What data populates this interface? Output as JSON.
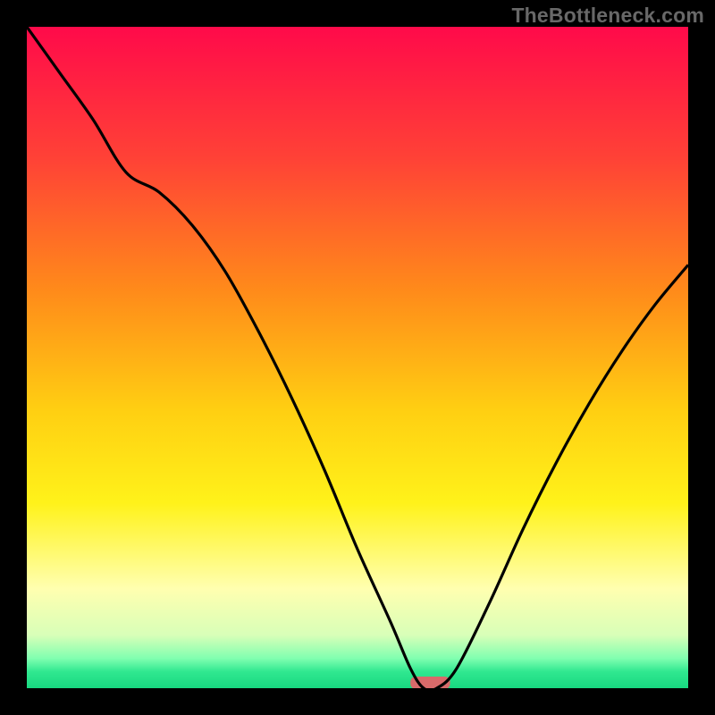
{
  "watermark": "TheBottleneck.com",
  "chart_data": {
    "type": "line",
    "title": "",
    "xlabel": "",
    "ylabel": "",
    "xlim": [
      0,
      100
    ],
    "ylim": [
      0,
      100
    ],
    "grid": false,
    "axes_visible": false,
    "series": [
      {
        "name": "bottleneck-curve",
        "x": [
          0,
          5,
          10,
          15,
          20,
          25,
          30,
          35,
          40,
          45,
          50,
          55,
          58,
          60,
          62,
          65,
          70,
          75,
          80,
          85,
          90,
          95,
          100
        ],
        "y": [
          100,
          93,
          86,
          78,
          75,
          70,
          63,
          54,
          44,
          33,
          21,
          10,
          3,
          0,
          0,
          3,
          13,
          24,
          34,
          43,
          51,
          58,
          64
        ]
      }
    ],
    "optimal_marker": {
      "x_range": [
        58,
        64
      ],
      "y": 0,
      "color": "#d86a6a"
    },
    "background_gradient": {
      "stops": [
        {
          "pos": 0.0,
          "color": "#ff0a4a"
        },
        {
          "pos": 0.2,
          "color": "#ff4236"
        },
        {
          "pos": 0.4,
          "color": "#ff8b1a"
        },
        {
          "pos": 0.58,
          "color": "#ffcf12"
        },
        {
          "pos": 0.72,
          "color": "#fff21a"
        },
        {
          "pos": 0.85,
          "color": "#ffffb0"
        },
        {
          "pos": 0.92,
          "color": "#d8ffb8"
        },
        {
          "pos": 0.955,
          "color": "#80ffb0"
        },
        {
          "pos": 0.975,
          "color": "#30e890"
        },
        {
          "pos": 1.0,
          "color": "#18d880"
        }
      ]
    }
  }
}
